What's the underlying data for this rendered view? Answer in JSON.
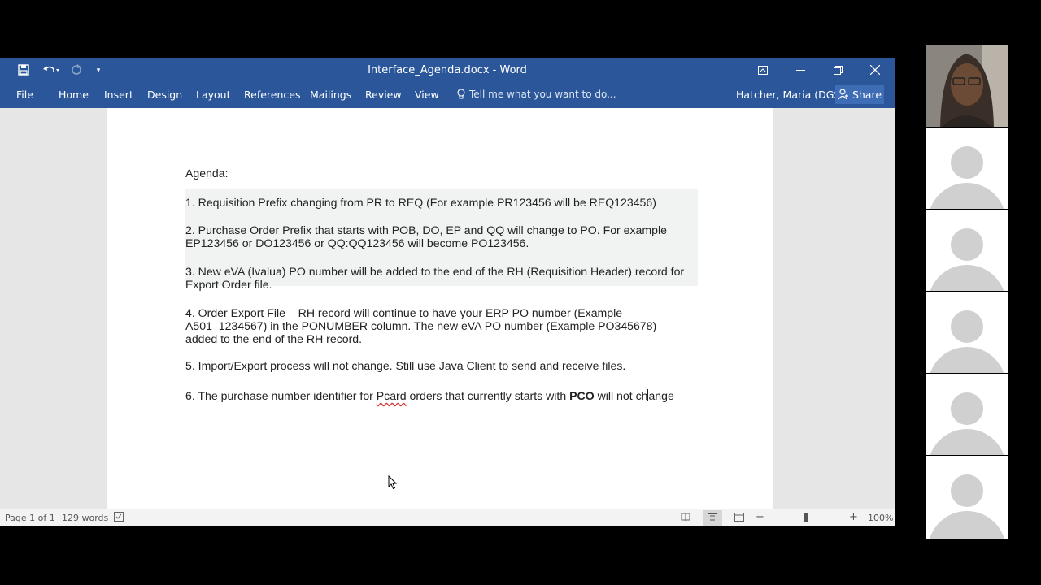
{
  "window": {
    "title": "Interface_Agenda.docx - Word",
    "controls": [
      "restore-ribbon-icon",
      "minimize-icon",
      "restore-icon",
      "close-icon"
    ]
  },
  "ribbon": {
    "tabs": [
      "File",
      "Home",
      "Insert",
      "Design",
      "Layout",
      "References",
      "Mailings",
      "Review",
      "View"
    ],
    "tell_me": "Tell me what you want to do...",
    "user": "Hatcher, Maria (DGS)",
    "share": "Share"
  },
  "document": {
    "heading": "Agenda:",
    "items": [
      [
        "1.  Requisition Prefix changing from PR to REQ (For example PR123456 will be REQ123456)"
      ],
      [
        "2. Purchase Order Prefix that starts with POB, DO, EP and QQ will change to PO.  For example",
        "EP123456 or DO123456 or QQ:QQ123456 will become PO123456."
      ],
      [
        "3.  New eVA (Ivalua) PO number will be added to the end of the RH (Requisition Header) record for",
        "Export Order file."
      ],
      [
        "4.  Order Export File – RH record will continue to have your ERP PO number (Example",
        "A501_1234567) in the PONUMBER column.  The new eVA PO number (Example PO345678)",
        "added to the end of the RH record."
      ],
      [
        "5.  Import/Export process will not change.  Still use Java Client to send and receive files."
      ],
      [
        "6.  The purchase number identifier for Pcard orders that currently starts with PCO will not change"
      ]
    ],
    "item6": {
      "prefix": "6.  The purchase number identifier for ",
      "pcard": "Pcard",
      "mid": " orders that currently starts with ",
      "bold": "PCO",
      "suffix_a": " will not ch",
      "suffix_b": "ange"
    }
  },
  "status_bar": {
    "page": "Page 1 of 1",
    "words": "129 words",
    "zoom": "100%"
  },
  "participants": {
    "count": 6,
    "active_speaker_index": 0
  }
}
